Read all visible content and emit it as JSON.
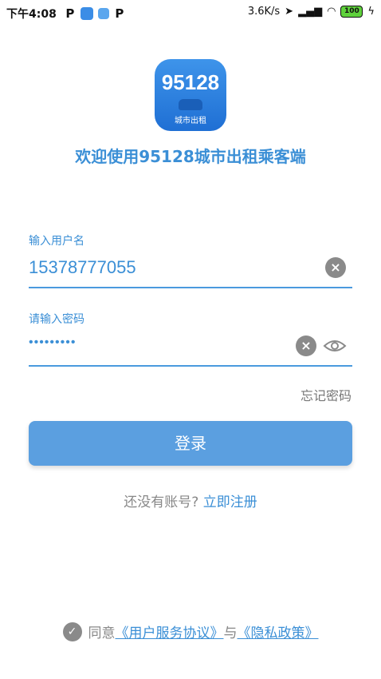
{
  "status_bar": {
    "time": "下午4:08",
    "net_speed": "3.6K/s",
    "battery": "100"
  },
  "logo": {
    "number": "95128",
    "subtitle": "城市出租"
  },
  "welcome_text": "欢迎使用95128城市出租乘客端",
  "username": {
    "label": "输入用户名",
    "value": "15378777055"
  },
  "password": {
    "label": "请输入密码",
    "value": "•••••••••"
  },
  "forgot_password": "忘记密码",
  "login_button": "登录",
  "register": {
    "prompt": "还没有账号?",
    "link": "立即注册"
  },
  "agreement": {
    "agree": "同意",
    "user_agreement": "《用户服务协议》",
    "and": "与",
    "privacy_policy": "《隐私政策》"
  },
  "colors": {
    "accent": "#3b8fd6",
    "button": "#5b9fe0"
  }
}
